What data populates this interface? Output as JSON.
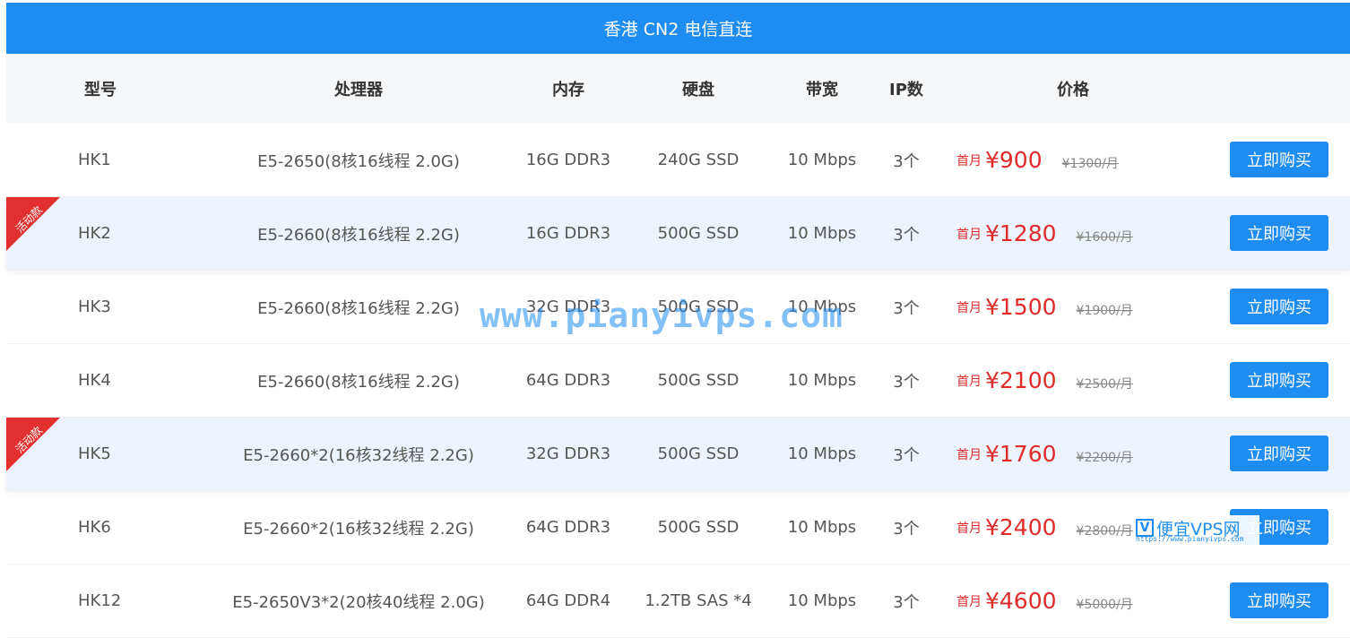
{
  "title": "香港 CN2 电信直连",
  "headers": {
    "model": "型号",
    "cpu": "处理器",
    "memory": "内存",
    "disk": "硬盘",
    "bandwidth": "带宽",
    "ip": "IP数",
    "price": "价格"
  },
  "promo_label": "活动款",
  "price_prefix": "首月",
  "buy_label": "立即购买",
  "rows": [
    {
      "model": "HK1",
      "cpu": "E5-2650(8核16线程 2.0G)",
      "memory": "16G DDR3",
      "disk": "240G SSD",
      "bandwidth": "10 Mbps",
      "ip": "3个",
      "price": "¥900",
      "original": "¥1300/月",
      "promo": false
    },
    {
      "model": "HK2",
      "cpu": "E5-2660(8核16线程 2.2G)",
      "memory": "16G DDR3",
      "disk": "500G SSD",
      "bandwidth": "10 Mbps",
      "ip": "3个",
      "price": "¥1280",
      "original": "¥1600/月",
      "promo": true
    },
    {
      "model": "HK3",
      "cpu": "E5-2660(8核16线程 2.2G)",
      "memory": "32G DDR3",
      "disk": "500G SSD",
      "bandwidth": "10 Mbps",
      "ip": "3个",
      "price": "¥1500",
      "original": "¥1900/月",
      "promo": false
    },
    {
      "model": "HK4",
      "cpu": "E5-2660(8核16线程 2.2G)",
      "memory": "64G DDR3",
      "disk": "500G SSD",
      "bandwidth": "10 Mbps",
      "ip": "3个",
      "price": "¥2100",
      "original": "¥2500/月",
      "promo": false
    },
    {
      "model": "HK5",
      "cpu": "E5-2660*2(16核32线程 2.2G)",
      "memory": "32G DDR3",
      "disk": "500G SSD",
      "bandwidth": "10 Mbps",
      "ip": "3个",
      "price": "¥1760",
      "original": "¥2200/月",
      "promo": true
    },
    {
      "model": "HK6",
      "cpu": "E5-2660*2(16核32线程 2.2G)",
      "memory": "64G DDR3",
      "disk": "500G SSD",
      "bandwidth": "10 Mbps",
      "ip": "3个",
      "price": "¥2400",
      "original": "¥2800/月",
      "promo": false
    },
    {
      "model": "HK12",
      "cpu": "E5-2650V3*2(20核40线程 2.0G)",
      "memory": "64G DDR4",
      "disk": "1.2TB SAS *4",
      "bandwidth": "10 Mbps",
      "ip": "3个",
      "price": "¥4600",
      "original": "¥5000/月",
      "promo": false
    }
  ],
  "watermark": "www.pianyivps.com",
  "logo": {
    "icon": "V",
    "text": "便宜VPS网",
    "url": "https://www.pianyivps.com"
  },
  "colors": {
    "accent": "#1e8cf0",
    "price": "#e02b2b",
    "promo_ribbon": "#e23030",
    "promo_row_bg": "#edf3fc"
  }
}
